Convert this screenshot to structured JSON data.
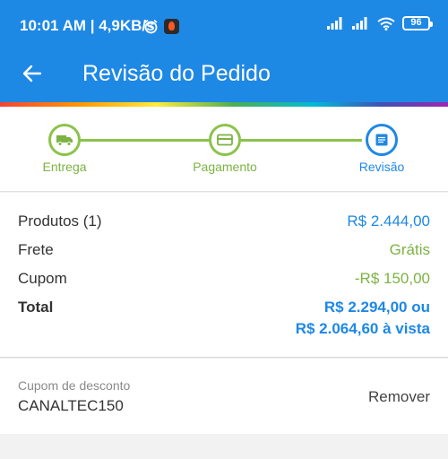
{
  "status_bar": {
    "time_net": "10:01 AM | 4,9KB/s",
    "battery": "96",
    "icons": [
      "alarm-icon",
      "app-notification-icon",
      "signal-icon",
      "signal-icon",
      "wifi-icon",
      "battery-icon"
    ]
  },
  "header": {
    "title": "Revisão do Pedido",
    "back_icon": "arrow-left-icon",
    "background": "#1e88e5"
  },
  "steps": [
    {
      "label": "Entrega",
      "icon": "truck-icon",
      "state": "done"
    },
    {
      "label": "Pagamento",
      "icon": "card-icon",
      "state": "done"
    },
    {
      "label": "Revisão",
      "icon": "document-icon",
      "state": "active"
    }
  ],
  "summary": {
    "products_label": "Produtos (1)",
    "products_value": "R$ 2.444,00",
    "shipping_label": "Frete",
    "shipping_value": "Grátis",
    "coupon_label": "Cupom",
    "coupon_value": "-R$ 150,00",
    "total_label": "Total",
    "total_value_1": "R$ 2.294,00 ou",
    "total_value_2": "R$ 2.064,60 à vista"
  },
  "coupon": {
    "label": "Cupom de desconto",
    "code": "CANALTEC150",
    "remove_label": "Remover"
  },
  "colors": {
    "primary": "#1e88e5",
    "success": "#7cb342"
  }
}
